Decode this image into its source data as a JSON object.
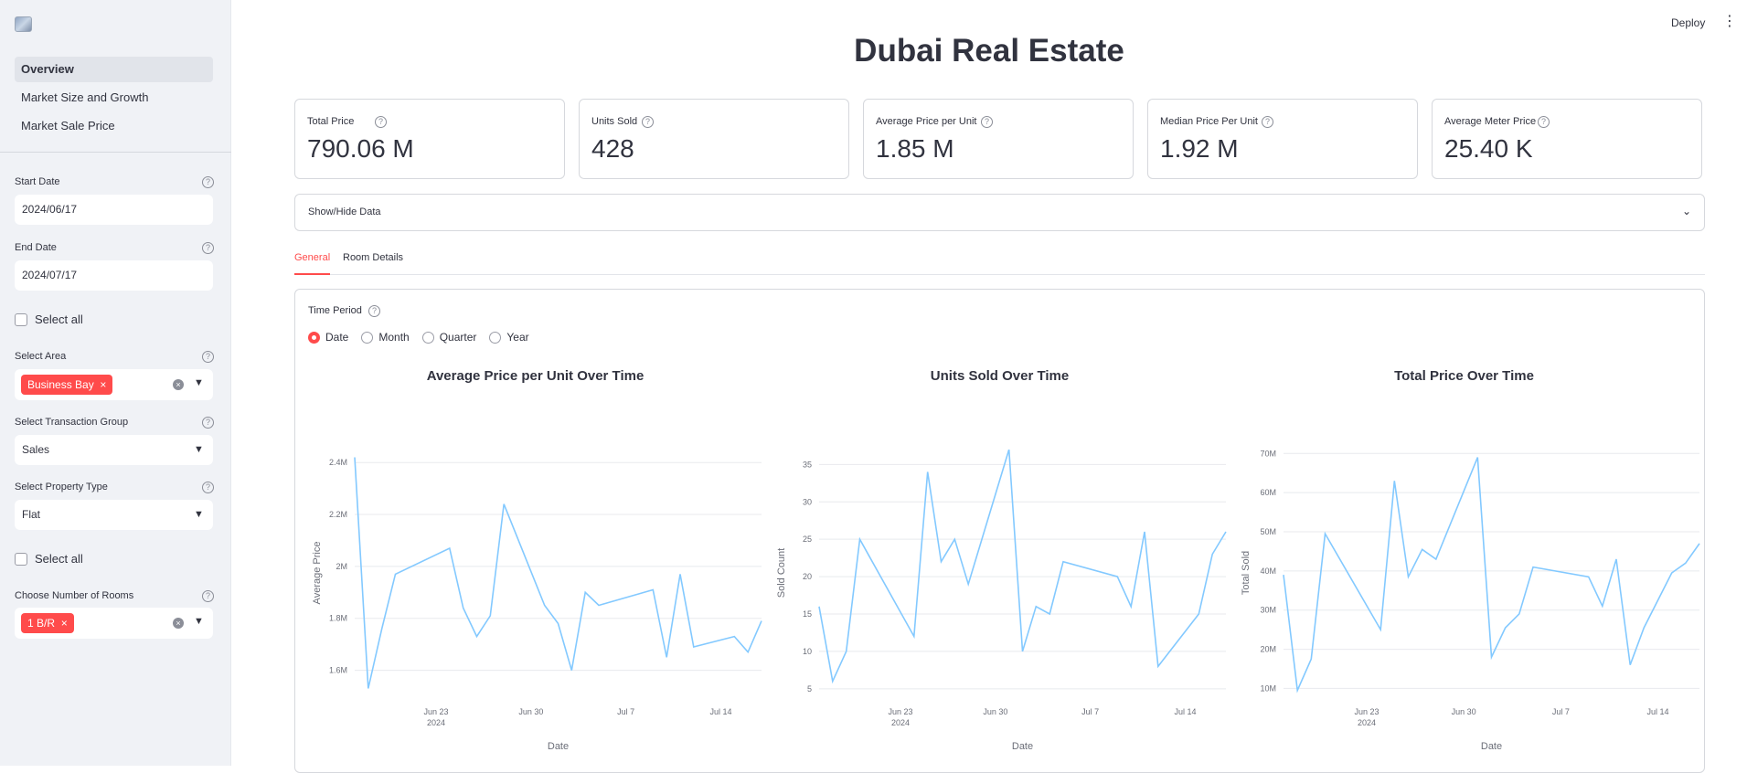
{
  "sidebar": {
    "nav": [
      "Overview",
      "Market Size and Growth",
      "Market Sale Price"
    ],
    "start_date_label": "Start Date",
    "start_date": "2024/06/17",
    "end_date_label": "End Date",
    "end_date": "2024/07/17",
    "select_all_1": "Select all",
    "select_area_label": "Select Area",
    "area_chip": "Business Bay",
    "transaction_label": "Select Transaction Group",
    "transaction_value": "Sales",
    "property_label": "Select Property Type",
    "property_value": "Flat",
    "select_all_2": "Select all",
    "rooms_label": "Choose Number of Rooms",
    "rooms_chip": "1 B/R"
  },
  "header": {
    "title": "Dubai Real Estate",
    "deploy": "Deploy"
  },
  "metrics": [
    {
      "label": "Total Price",
      "value": "790.06 M"
    },
    {
      "label": "Units Sold",
      "value": "428"
    },
    {
      "label": "Average Price per Unit",
      "value": "1.85 M"
    },
    {
      "label": "Median Price Per Unit",
      "value": "1.92 M"
    },
    {
      "label": "Average Meter Price",
      "value": "25.40 K"
    }
  ],
  "expander": {
    "label": "Show/Hide Data"
  },
  "tabs": [
    "General",
    "Room Details"
  ],
  "panel": {
    "time_period_label": "Time Period",
    "options": [
      "Date",
      "Month",
      "Quarter",
      "Year"
    ],
    "selected": "Date"
  },
  "colors": {
    "accent": "#ff4b4b",
    "line": "#83c9ff"
  },
  "chart_data": [
    {
      "type": "line",
      "title": "Average Price per Unit Over Time",
      "xlabel": "Date",
      "ylabel": "Average Price",
      "x_ticks": [
        "Jun 23\n2024",
        "Jun 30",
        "Jul 7",
        "Jul 14"
      ],
      "y_ticks": [
        "1.6M",
        "1.8M",
        "2M",
        "2.2M",
        "2.4M"
      ],
      "ylim": [
        1.5,
        2.45
      ],
      "x": [
        "2024-06-17",
        "2024-06-18",
        "2024-06-19",
        "2024-06-20",
        "2024-06-24",
        "2024-06-25",
        "2024-06-26",
        "2024-06-27",
        "2024-06-28",
        "2024-07-01",
        "2024-07-02",
        "2024-07-03",
        "2024-07-04",
        "2024-07-05",
        "2024-07-09",
        "2024-07-10",
        "2024-07-11",
        "2024-07-12",
        "2024-07-15",
        "2024-07-16",
        "2024-07-17"
      ],
      "values": [
        2.42,
        1.53,
        1.76,
        1.97,
        2.07,
        1.84,
        1.73,
        1.81,
        2.24,
        1.85,
        1.78,
        1.6,
        1.9,
        1.85,
        1.91,
        1.65,
        1.97,
        1.69,
        1.73,
        1.67,
        1.79
      ]
    },
    {
      "type": "line",
      "title": "Units Sold Over Time",
      "xlabel": "Date",
      "ylabel": "Sold Count",
      "x_ticks": [
        "Jun 23\n2024",
        "Jun 30",
        "Jul 7",
        "Jul 14"
      ],
      "y_ticks": [
        "5",
        "10",
        "15",
        "20",
        "25",
        "30",
        "35"
      ],
      "ylim": [
        4,
        37
      ],
      "x": [
        "2024-06-17",
        "2024-06-18",
        "2024-06-19",
        "2024-06-20",
        "2024-06-24",
        "2024-06-25",
        "2024-06-26",
        "2024-06-27",
        "2024-06-28",
        "2024-07-01",
        "2024-07-02",
        "2024-07-03",
        "2024-07-04",
        "2024-07-05",
        "2024-07-09",
        "2024-07-10",
        "2024-07-11",
        "2024-07-12",
        "2024-07-15",
        "2024-07-16",
        "2024-07-17"
      ],
      "values": [
        16,
        6,
        10,
        25,
        12,
        34,
        22,
        25,
        19,
        37,
        10,
        16,
        15,
        22,
        20,
        16,
        26,
        8,
        15,
        23,
        26
      ]
    },
    {
      "type": "line",
      "title": "Total Price Over Time",
      "xlabel": "Date",
      "ylabel": "Total Sold",
      "x_ticks": [
        "Jun 23\n2024",
        "Jun 30",
        "Jul 7",
        "Jul 14"
      ],
      "y_ticks": [
        "10M",
        "20M",
        "30M",
        "40M",
        "50M",
        "60M",
        "70M"
      ],
      "ylim": [
        8,
        71
      ],
      "x": [
        "2024-06-17",
        "2024-06-18",
        "2024-06-19",
        "2024-06-20",
        "2024-06-24",
        "2024-06-25",
        "2024-06-26",
        "2024-06-27",
        "2024-06-28",
        "2024-07-01",
        "2024-07-02",
        "2024-07-03",
        "2024-07-04",
        "2024-07-05",
        "2024-07-09",
        "2024-07-10",
        "2024-07-11",
        "2024-07-12",
        "2024-07-13",
        "2024-07-15",
        "2024-07-16",
        "2024-07-17"
      ],
      "values": [
        39,
        9.5,
        17.5,
        49.5,
        25,
        63,
        38.5,
        45.5,
        43,
        69,
        18,
        25.5,
        29,
        41,
        38.5,
        31,
        43,
        16,
        25.5,
        39.5,
        42,
        47
      ]
    }
  ]
}
